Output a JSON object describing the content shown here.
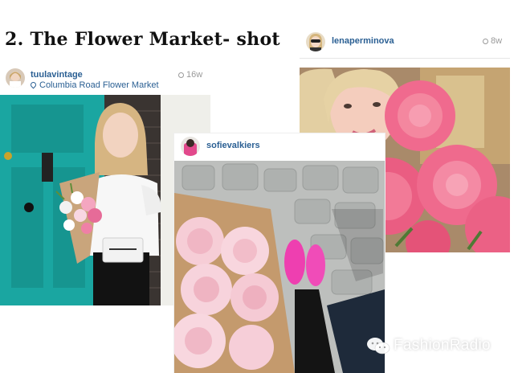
{
  "heading": "2. The Flower Market- shot",
  "posts": [
    {
      "username": "tuulavintage",
      "location": "Columbia Road Flower Market",
      "time": "16w",
      "photo_icon": "photo-woman-with-flowers-turquoise-door"
    },
    {
      "username": "sofievalkiers",
      "time": "",
      "photo_icon": "photo-pink-roses-bouquet-pink-shoes"
    },
    {
      "username": "lenaperminova",
      "time": "8w",
      "photo_icon": "photo-woman-with-pink-peonies"
    }
  ],
  "watermark": {
    "text": "FashionRadio",
    "icon": "wechat-icon"
  },
  "colors": {
    "username": "#2a5f93",
    "time": "#9a9a9a",
    "door": "#1aa6a1",
    "peony": "#ef5f83"
  }
}
